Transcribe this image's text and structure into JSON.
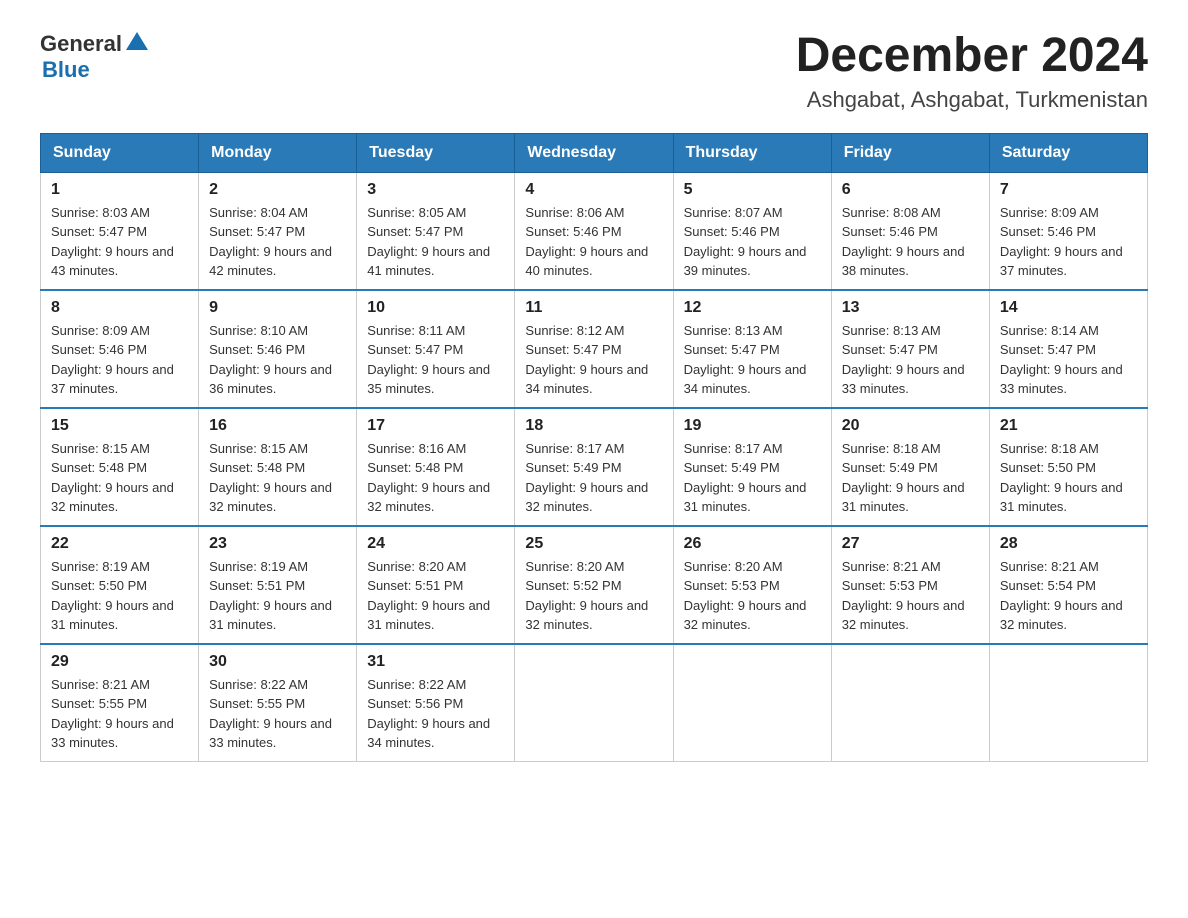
{
  "header": {
    "logo_general": "General",
    "logo_blue": "Blue",
    "month_title": "December 2024",
    "location": "Ashgabat, Ashgabat, Turkmenistan"
  },
  "days_of_week": [
    "Sunday",
    "Monday",
    "Tuesday",
    "Wednesday",
    "Thursday",
    "Friday",
    "Saturday"
  ],
  "weeks": [
    [
      {
        "day": "1",
        "sunrise": "Sunrise: 8:03 AM",
        "sunset": "Sunset: 5:47 PM",
        "daylight": "Daylight: 9 hours and 43 minutes."
      },
      {
        "day": "2",
        "sunrise": "Sunrise: 8:04 AM",
        "sunset": "Sunset: 5:47 PM",
        "daylight": "Daylight: 9 hours and 42 minutes."
      },
      {
        "day": "3",
        "sunrise": "Sunrise: 8:05 AM",
        "sunset": "Sunset: 5:47 PM",
        "daylight": "Daylight: 9 hours and 41 minutes."
      },
      {
        "day": "4",
        "sunrise": "Sunrise: 8:06 AM",
        "sunset": "Sunset: 5:46 PM",
        "daylight": "Daylight: 9 hours and 40 minutes."
      },
      {
        "day": "5",
        "sunrise": "Sunrise: 8:07 AM",
        "sunset": "Sunset: 5:46 PM",
        "daylight": "Daylight: 9 hours and 39 minutes."
      },
      {
        "day": "6",
        "sunrise": "Sunrise: 8:08 AM",
        "sunset": "Sunset: 5:46 PM",
        "daylight": "Daylight: 9 hours and 38 minutes."
      },
      {
        "day": "7",
        "sunrise": "Sunrise: 8:09 AM",
        "sunset": "Sunset: 5:46 PM",
        "daylight": "Daylight: 9 hours and 37 minutes."
      }
    ],
    [
      {
        "day": "8",
        "sunrise": "Sunrise: 8:09 AM",
        "sunset": "Sunset: 5:46 PM",
        "daylight": "Daylight: 9 hours and 37 minutes."
      },
      {
        "day": "9",
        "sunrise": "Sunrise: 8:10 AM",
        "sunset": "Sunset: 5:46 PM",
        "daylight": "Daylight: 9 hours and 36 minutes."
      },
      {
        "day": "10",
        "sunrise": "Sunrise: 8:11 AM",
        "sunset": "Sunset: 5:47 PM",
        "daylight": "Daylight: 9 hours and 35 minutes."
      },
      {
        "day": "11",
        "sunrise": "Sunrise: 8:12 AM",
        "sunset": "Sunset: 5:47 PM",
        "daylight": "Daylight: 9 hours and 34 minutes."
      },
      {
        "day": "12",
        "sunrise": "Sunrise: 8:13 AM",
        "sunset": "Sunset: 5:47 PM",
        "daylight": "Daylight: 9 hours and 34 minutes."
      },
      {
        "day": "13",
        "sunrise": "Sunrise: 8:13 AM",
        "sunset": "Sunset: 5:47 PM",
        "daylight": "Daylight: 9 hours and 33 minutes."
      },
      {
        "day": "14",
        "sunrise": "Sunrise: 8:14 AM",
        "sunset": "Sunset: 5:47 PM",
        "daylight": "Daylight: 9 hours and 33 minutes."
      }
    ],
    [
      {
        "day": "15",
        "sunrise": "Sunrise: 8:15 AM",
        "sunset": "Sunset: 5:48 PM",
        "daylight": "Daylight: 9 hours and 32 minutes."
      },
      {
        "day": "16",
        "sunrise": "Sunrise: 8:15 AM",
        "sunset": "Sunset: 5:48 PM",
        "daylight": "Daylight: 9 hours and 32 minutes."
      },
      {
        "day": "17",
        "sunrise": "Sunrise: 8:16 AM",
        "sunset": "Sunset: 5:48 PM",
        "daylight": "Daylight: 9 hours and 32 minutes."
      },
      {
        "day": "18",
        "sunrise": "Sunrise: 8:17 AM",
        "sunset": "Sunset: 5:49 PM",
        "daylight": "Daylight: 9 hours and 32 minutes."
      },
      {
        "day": "19",
        "sunrise": "Sunrise: 8:17 AM",
        "sunset": "Sunset: 5:49 PM",
        "daylight": "Daylight: 9 hours and 31 minutes."
      },
      {
        "day": "20",
        "sunrise": "Sunrise: 8:18 AM",
        "sunset": "Sunset: 5:49 PM",
        "daylight": "Daylight: 9 hours and 31 minutes."
      },
      {
        "day": "21",
        "sunrise": "Sunrise: 8:18 AM",
        "sunset": "Sunset: 5:50 PM",
        "daylight": "Daylight: 9 hours and 31 minutes."
      }
    ],
    [
      {
        "day": "22",
        "sunrise": "Sunrise: 8:19 AM",
        "sunset": "Sunset: 5:50 PM",
        "daylight": "Daylight: 9 hours and 31 minutes."
      },
      {
        "day": "23",
        "sunrise": "Sunrise: 8:19 AM",
        "sunset": "Sunset: 5:51 PM",
        "daylight": "Daylight: 9 hours and 31 minutes."
      },
      {
        "day": "24",
        "sunrise": "Sunrise: 8:20 AM",
        "sunset": "Sunset: 5:51 PM",
        "daylight": "Daylight: 9 hours and 31 minutes."
      },
      {
        "day": "25",
        "sunrise": "Sunrise: 8:20 AM",
        "sunset": "Sunset: 5:52 PM",
        "daylight": "Daylight: 9 hours and 32 minutes."
      },
      {
        "day": "26",
        "sunrise": "Sunrise: 8:20 AM",
        "sunset": "Sunset: 5:53 PM",
        "daylight": "Daylight: 9 hours and 32 minutes."
      },
      {
        "day": "27",
        "sunrise": "Sunrise: 8:21 AM",
        "sunset": "Sunset: 5:53 PM",
        "daylight": "Daylight: 9 hours and 32 minutes."
      },
      {
        "day": "28",
        "sunrise": "Sunrise: 8:21 AM",
        "sunset": "Sunset: 5:54 PM",
        "daylight": "Daylight: 9 hours and 32 minutes."
      }
    ],
    [
      {
        "day": "29",
        "sunrise": "Sunrise: 8:21 AM",
        "sunset": "Sunset: 5:55 PM",
        "daylight": "Daylight: 9 hours and 33 minutes."
      },
      {
        "day": "30",
        "sunrise": "Sunrise: 8:22 AM",
        "sunset": "Sunset: 5:55 PM",
        "daylight": "Daylight: 9 hours and 33 minutes."
      },
      {
        "day": "31",
        "sunrise": "Sunrise: 8:22 AM",
        "sunset": "Sunset: 5:56 PM",
        "daylight": "Daylight: 9 hours and 34 minutes."
      },
      null,
      null,
      null,
      null
    ]
  ]
}
